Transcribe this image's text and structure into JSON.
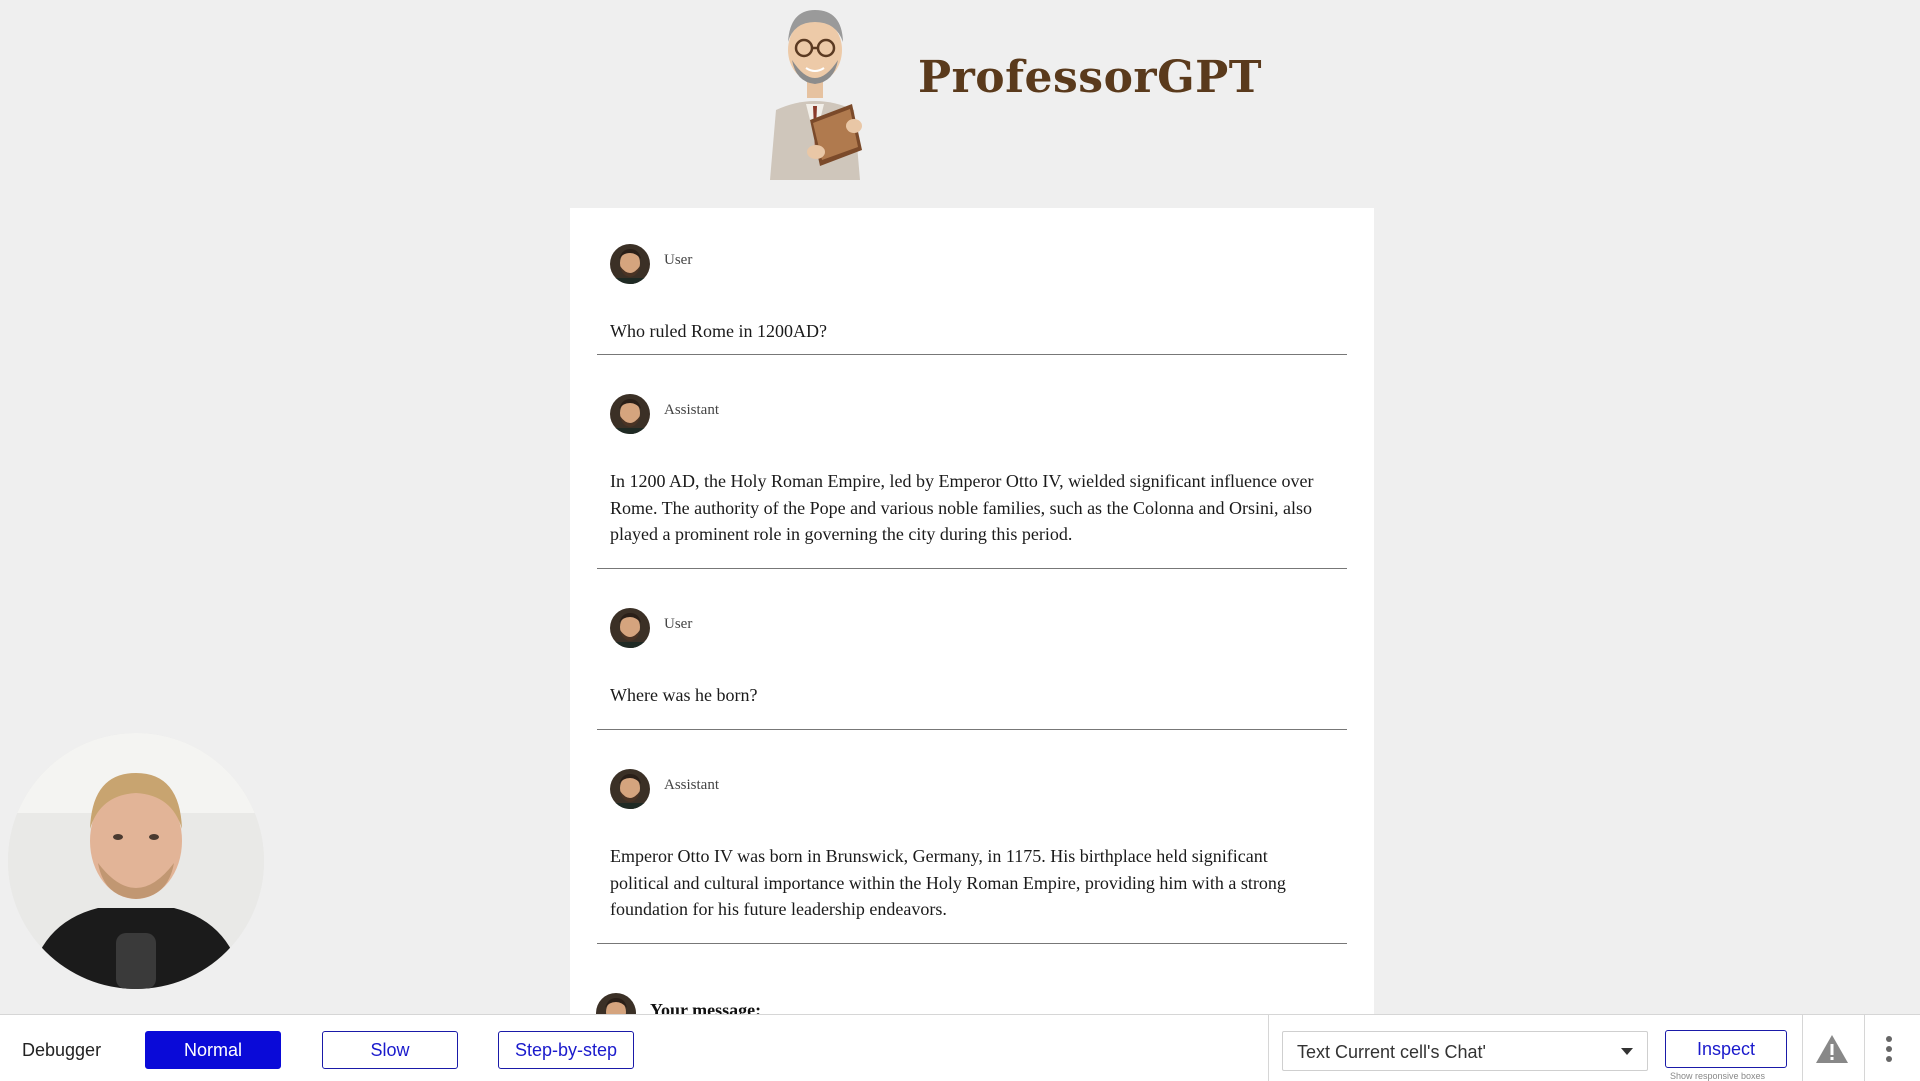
{
  "header": {
    "title": "ProfessorGPT",
    "logo_icon": "professor-avatar-icon"
  },
  "messages": [
    {
      "role": "User",
      "text": "Who ruled Rome in 1200AD?"
    },
    {
      "role": "Assistant",
      "text": "In 1200 AD, the Holy Roman Empire, led by Emperor Otto IV, wielded significant influence over Rome. The authority of the Pope and various noble families, such as the Colonna and Orsini, also played a prominent role in governing the city during this period."
    },
    {
      "role": "User",
      "text": "Where was he born?"
    },
    {
      "role": "Assistant",
      "text": "Emperor Otto IV was born in Brunswick, Germany, in 1175. His birthplace held significant political and cultural importance within the Holy Roman Empire, providing him with a strong foundation for his future leadership endeavors."
    }
  ],
  "composer": {
    "label": "Your message:"
  },
  "debugger": {
    "label": "Debugger",
    "modes": [
      "Normal",
      "Slow",
      "Step-by-step"
    ],
    "active_mode": "Normal",
    "select_value": "Text Current cell's Chat'",
    "inspect_label": "Inspect",
    "inspect_sub": "Show responsive boxes",
    "accent_color": "#0a0ad8"
  },
  "colors": {
    "title": "#5a3a1c",
    "background": "#efefef"
  }
}
